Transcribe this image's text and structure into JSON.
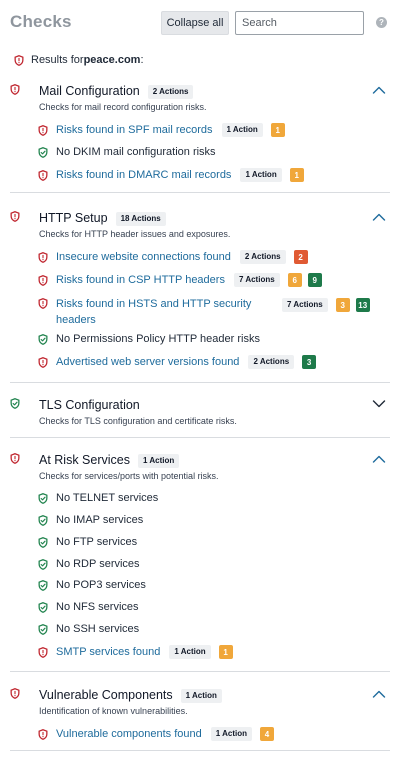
{
  "header": {
    "title": "Checks",
    "collapse_label": "Collapse all",
    "search_placeholder": "Search",
    "help_glyph": "?"
  },
  "results": {
    "prefix": "Results for ",
    "domain": "peace.com",
    "suffix": ":"
  },
  "colors": {
    "risk": "#c0262f",
    "safe": "#22844f",
    "link": "#1e6b9c",
    "count_orange": "#f0a73a",
    "count_red": "#e05a33",
    "count_green": "#1e7a4a"
  },
  "sections": [
    {
      "title": "Mail Configuration",
      "badge": "2 Actions",
      "description": "Checks for mail record configuration risks.",
      "status": "risk",
      "expanded": true,
      "items": [
        {
          "text": "Risks found in SPF mail records",
          "status": "risk",
          "badge": "1 Action",
          "counts": [
            "1"
          ]
        },
        {
          "text": "No DKIM mail configuration risks",
          "status": "safe"
        },
        {
          "text": "Risks found in DMARC mail records",
          "status": "risk",
          "badge": "1 Action",
          "counts": [
            "1"
          ]
        }
      ]
    },
    {
      "title": "HTTP Setup",
      "badge": "18 Actions",
      "description": "Checks for HTTP header issues and exposures.",
      "status": "risk",
      "expanded": true,
      "items": [
        {
          "text": "Insecure website connections found",
          "status": "risk",
          "badge": "2 Actions",
          "counts": [
            "2"
          ]
        },
        {
          "text": "Risks found in CSP HTTP headers",
          "status": "risk",
          "badge": "7 Actions",
          "counts": [
            "6",
            "9"
          ]
        },
        {
          "text_line1": "Risks found in HSTS and HTTP security",
          "text_line2": "headers",
          "status": "risk",
          "badge": "7 Actions",
          "counts": [
            "3",
            "13"
          ]
        },
        {
          "text": "No Permissions Policy HTTP header risks",
          "status": "safe"
        },
        {
          "text": "Advertised web server versions found",
          "status": "risk",
          "badge": "2 Actions",
          "counts": [
            "3"
          ]
        }
      ]
    },
    {
      "title": "TLS Configuration",
      "description": "Checks for TLS configuration and certificate risks.",
      "status": "safe",
      "expanded": false
    },
    {
      "title": "At Risk Services",
      "badge": "1 Action",
      "description": "Checks for services/ports with potential risks.",
      "status": "risk",
      "expanded": true,
      "items": [
        {
          "text": "No TELNET services",
          "status": "safe"
        },
        {
          "text": "No IMAP services",
          "status": "safe"
        },
        {
          "text": "No FTP services",
          "status": "safe"
        },
        {
          "text": "No RDP services",
          "status": "safe"
        },
        {
          "text": "No POP3 services",
          "status": "safe"
        },
        {
          "text": "No NFS services",
          "status": "safe"
        },
        {
          "text": "No SSH services",
          "status": "safe"
        },
        {
          "text": "SMTP services found",
          "status": "risk",
          "badge": "1 Action",
          "counts": [
            "1"
          ]
        }
      ]
    },
    {
      "title": "Vulnerable Components",
      "badge": "1 Action",
      "description": "Identification of known vulnerabilities.",
      "status": "risk",
      "expanded": true,
      "items": [
        {
          "text": "Vulnerable components found",
          "status": "risk",
          "badge": "1 Action",
          "counts": [
            "4"
          ]
        }
      ]
    }
  ]
}
